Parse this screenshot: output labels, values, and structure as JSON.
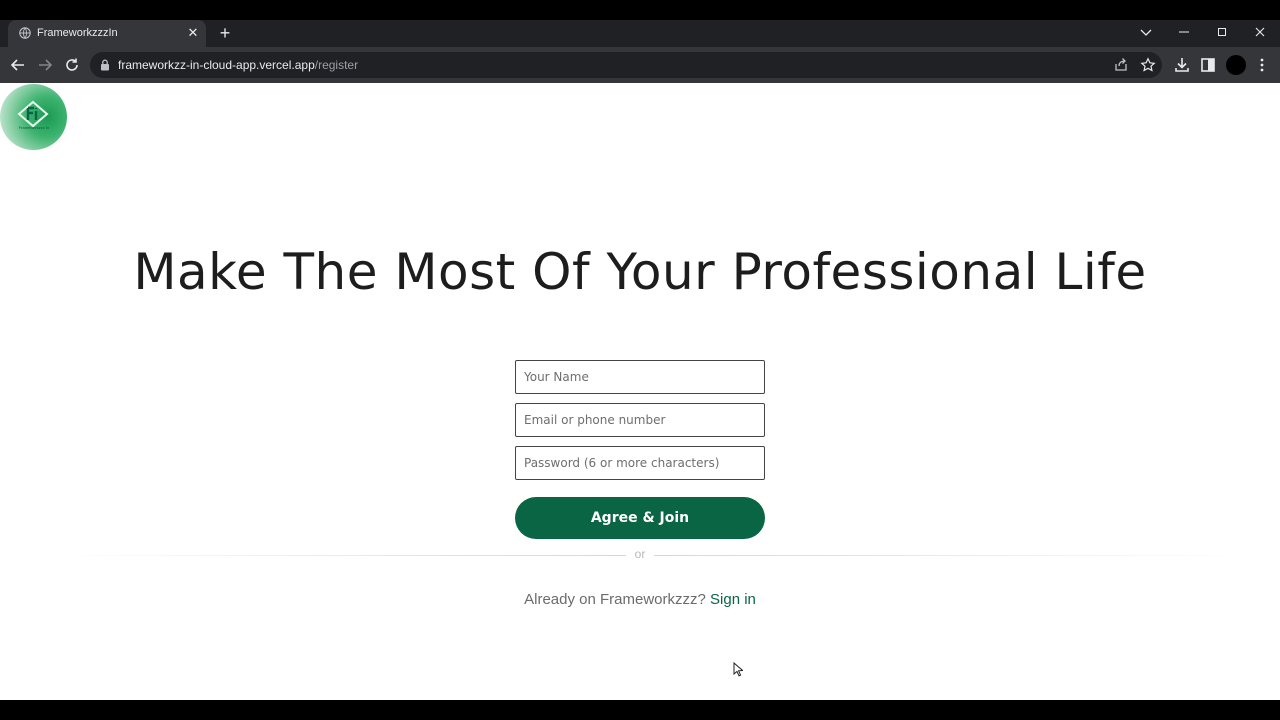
{
  "browser": {
    "tab": {
      "title": "FrameworkzzzIn",
      "favicon": "globe-icon"
    },
    "new_tab_icon": "plus-icon",
    "window_controls": [
      "chevron-down-icon",
      "minimize-icon",
      "restore-icon",
      "close-icon"
    ],
    "nav_icons": [
      "back-arrow-icon",
      "forward-arrow-icon",
      "reload-icon"
    ],
    "url": {
      "host": "frameworkzz-in-cloud-app.vercel.app",
      "path": "/register"
    },
    "omnibox_icons": [
      "share-icon",
      "star-icon"
    ],
    "toolbar_icons": [
      "download-icon",
      "side-panel-icon",
      "profile-avatar",
      "kebab-menu-icon"
    ]
  },
  "page": {
    "logo": {
      "text": "Frameworkzzz In",
      "color": "#0a6544"
    },
    "headline": "Make The Most Of Your Professional Life",
    "form": {
      "name_placeholder": "Your Name",
      "email_placeholder": "Email or phone number",
      "password_placeholder": "Password (6 or more characters)",
      "submit_label": "Agree & Join",
      "accent": "#0a6544"
    },
    "divider_text": "or",
    "signin": {
      "prompt": "Already on Frameworkzzz?",
      "link_label": "Sign in"
    }
  }
}
